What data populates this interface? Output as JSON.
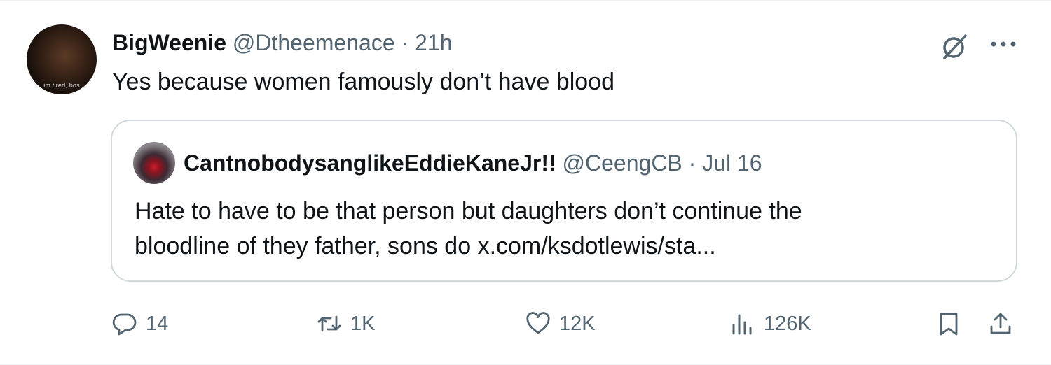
{
  "tweet": {
    "author_name": "BigWeenie",
    "author_handle": "@Dtheemenace",
    "separator": "·",
    "timestamp": "21h",
    "avatar_caption": "im tired, bos",
    "text": "Yes because women famously don’t have blood"
  },
  "quote": {
    "author_name": "CantnobodysanglikeEddieKaneJr!!",
    "author_handle": "@CeengCB",
    "separator": "·",
    "timestamp": "Jul 16",
    "text_line1": "Hate to have to be that person but daughters don’t continue the",
    "text_line2": "bloodline of they father, sons do x.com/ksdotlewis/sta..."
  },
  "actions": {
    "replies": "14",
    "reposts": "1K",
    "likes": "12K",
    "views": "126K"
  },
  "icons": {
    "grok": "grok-icon",
    "more": "more-icon",
    "reply": "reply-icon",
    "repost": "repost-icon",
    "like": "like-icon",
    "views": "views-icon",
    "bookmark": "bookmark-icon",
    "share": "share-icon"
  },
  "colors": {
    "text_primary": "#0f1419",
    "text_secondary": "#536471",
    "border": "#cfd9de"
  }
}
